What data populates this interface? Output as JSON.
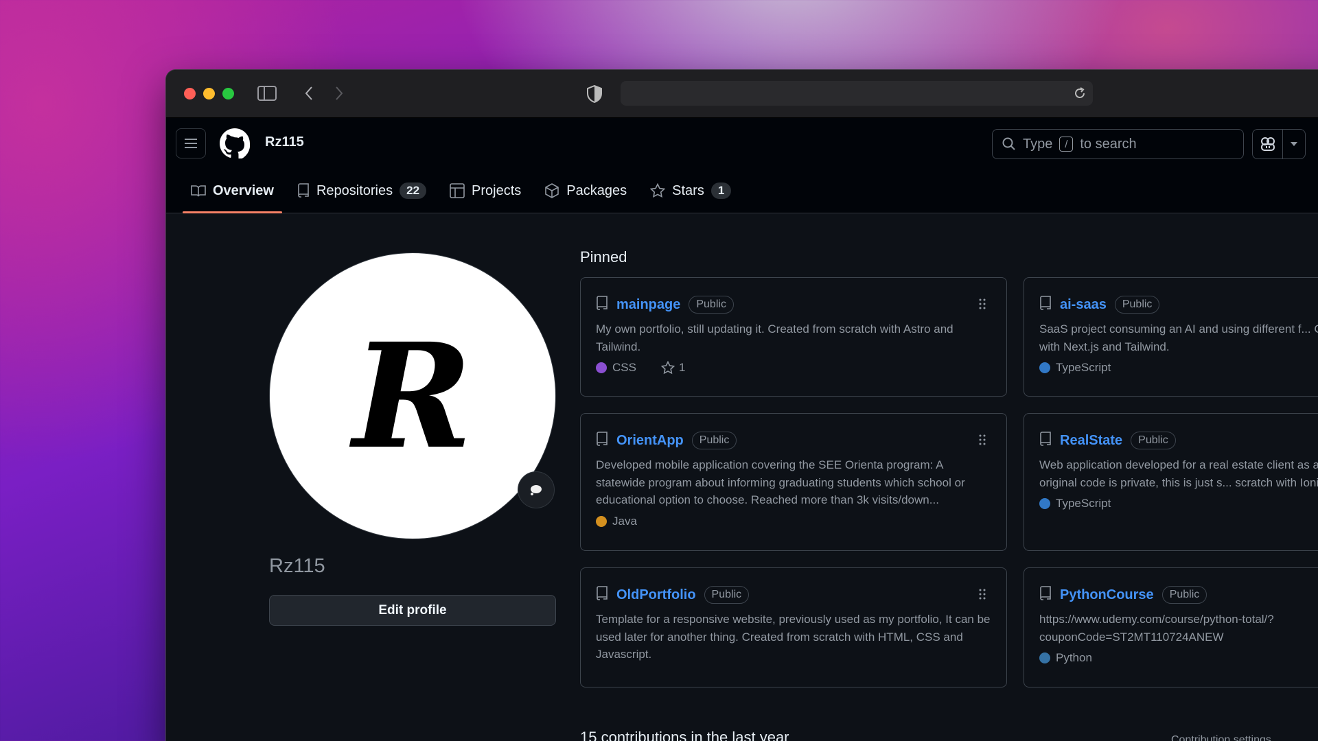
{
  "browser": {
    "traffic_colors": [
      "#ff5f57",
      "#febc2e",
      "#28c840"
    ]
  },
  "header": {
    "username": "Rz115",
    "search_prefix": "Type",
    "search_key": "/",
    "search_suffix": "to search"
  },
  "tabs": [
    {
      "label": "Overview",
      "icon": "book-icon",
      "active": true
    },
    {
      "label": "Repositories",
      "icon": "repo-icon",
      "count": "22"
    },
    {
      "label": "Projects",
      "icon": "table-icon"
    },
    {
      "label": "Packages",
      "icon": "package-icon"
    },
    {
      "label": "Stars",
      "icon": "star-icon",
      "count": "1"
    }
  ],
  "profile": {
    "avatar_letter": "R",
    "name": "Rz115",
    "edit_label": "Edit profile"
  },
  "pinned": {
    "heading": "Pinned",
    "cards": [
      {
        "name": "mainpage",
        "visibility": "Public",
        "description": "My own portfolio, still updating it. Created from scratch with Astro and Tailwind.",
        "language": "CSS",
        "lang_color": "#8b4fd1",
        "stars": "1"
      },
      {
        "name": "ai-saas",
        "visibility": "Public",
        "description": "SaaS project consuming an AI and using different f... Created from scratch with Next.js and Tailwind.",
        "language": "TypeScript",
        "lang_color": "#3178c6"
      },
      {
        "name": "OrientApp",
        "visibility": "Public",
        "description": "Developed mobile application covering the SEE Orienta program: A statewide program about informing graduating students which school or educational option to choose. Reached more than 3k visits/down...",
        "language": "Java",
        "lang_color": "#d4901f"
      },
      {
        "name": "RealState",
        "visibility": "Public",
        "description": "Web application developed for a real estate client as a freelancer. The original code is private, this is just s... scratch with Ionic and Typescript.",
        "language": "TypeScript",
        "lang_color": "#3178c6"
      },
      {
        "name": "OldPortfolio",
        "visibility": "Public",
        "description": "Template for a responsive website, previously used as my portfolio, It can be used later for another thing. Created from scratch with HTML, CSS and Javascript."
      },
      {
        "name": "PythonCourse",
        "visibility": "Public",
        "description": "https://www.udemy.com/course/python-total/?couponCode=ST2MT110724ANEW",
        "language": "Python",
        "lang_color": "#3572a5"
      }
    ]
  },
  "contributions": {
    "heading": "15 contributions in the last year",
    "settings": "Contribution settings"
  }
}
